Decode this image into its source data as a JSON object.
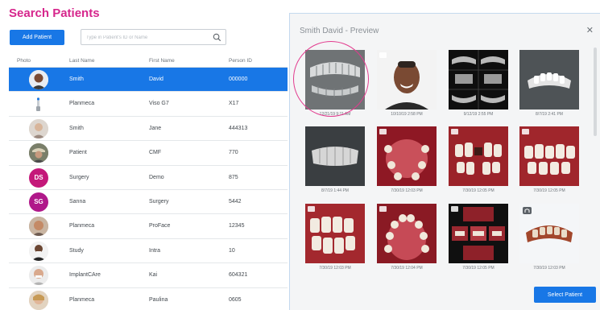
{
  "page": {
    "title": "Search Patients",
    "add_patient_label": "Add Patient",
    "search_placeholder": "Type in Patient's ID or Name"
  },
  "table": {
    "headers": [
      "Photo",
      "Last Name",
      "First Name",
      "Person ID"
    ],
    "rows": [
      {
        "last": "Smith",
        "first": "David",
        "pid": "000000",
        "selected": true
      },
      {
        "last": "Planmeca",
        "first": "Viso G7",
        "pid": "X17"
      },
      {
        "last": "Smith",
        "first": "Jane",
        "pid": "444313"
      },
      {
        "last": "Patient",
        "first": "CMF",
        "pid": "770"
      },
      {
        "last": "Surgery",
        "first": "Demo",
        "pid": "875",
        "initials": "DS"
      },
      {
        "last": "Sanna",
        "first": "Surgery",
        "pid": "5442",
        "initials": "SG"
      },
      {
        "last": "Planmeca",
        "first": "ProFace",
        "pid": "12345"
      },
      {
        "last": "Study",
        "first": "Intra",
        "pid": "10"
      },
      {
        "last": "ImplantCAre",
        "first": "Kai",
        "pid": "604321"
      },
      {
        "last": "Planmeca",
        "first": "Paulina",
        "pid": "0605"
      }
    ]
  },
  "preview": {
    "title": "Smith David - Preview",
    "select_label": "Select Patient",
    "images": [
      {
        "date": "12/21/19 9:11 AM"
      },
      {
        "date": "10/10/19 2:58 PM"
      },
      {
        "date": "9/12/19 2:55 PM"
      },
      {
        "date": "8/7/19 2:41 PM"
      },
      {
        "date": "8/7/19 1:44 PM"
      },
      {
        "date": "7/30/19 12:03 PM"
      },
      {
        "date": "7/30/19 12:05 PM"
      },
      {
        "date": "7/30/19 12:05 PM"
      },
      {
        "date": "7/30/19 12:03 PM"
      },
      {
        "date": "7/30/19 12:04 PM"
      },
      {
        "date": "7/30/19 12:05 PM"
      },
      {
        "date": "7/30/19 12:03 PM"
      }
    ]
  },
  "colors": {
    "accent": "#1877e6",
    "title_pink": "#d6268c",
    "highlight_circle": "#e23b8e",
    "avatar_ds": "#c4187a",
    "avatar_sg": "#b0188a"
  }
}
